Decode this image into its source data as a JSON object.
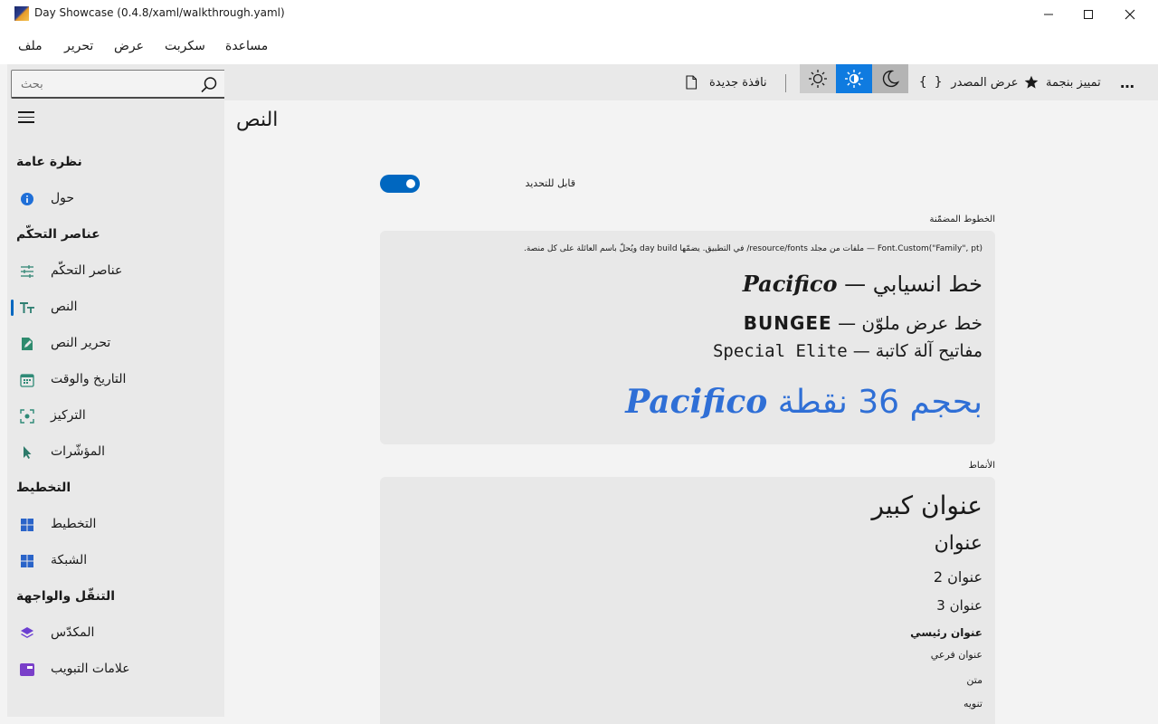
{
  "window": {
    "title": "Day Showcase (0.4.8/xaml/walkthrough.yaml)",
    "min_glyph": "—",
    "max_glyph": "☐",
    "close_glyph": "✕"
  },
  "menu": [
    "ملف",
    "تحرير",
    "عرض",
    "سكربت",
    "مساعدة"
  ],
  "search": {
    "placeholder": "بحث",
    "value": ""
  },
  "sidebar": {
    "sections": [
      "نظرة عامة",
      "عناصر التحكّم",
      "التخطيط",
      "التنقّل والواجهة"
    ],
    "items": [
      {
        "label": "حول",
        "icon": "info-icon"
      },
      {
        "label": "عناصر التحكّم",
        "icon": "sliders-icon"
      },
      {
        "label": "النص",
        "icon": "text-icon",
        "selected": true
      },
      {
        "label": "تحرير النص",
        "icon": "edit-text-icon"
      },
      {
        "label": "التاريخ والوقت",
        "icon": "calendar-icon"
      },
      {
        "label": "التركيز",
        "icon": "focus-icon"
      },
      {
        "label": "المؤشّرات",
        "icon": "pointer-icon"
      },
      {
        "label": "التخطيط",
        "icon": "layout-grid-icon"
      },
      {
        "label": "الشبكة",
        "icon": "grid-icon"
      },
      {
        "label": "المكدّس",
        "icon": "stack-layers-icon"
      },
      {
        "label": "علامات التبويب",
        "icon": "tabs-icon"
      }
    ]
  },
  "toolbar": {
    "new_window": "نافذة جديدة",
    "view_source": "عرض المصدر",
    "source_glyph": "{ }",
    "favorite": "تمييز بنجمة",
    "more": "…",
    "theme_modes": [
      "light",
      "auto",
      "dark"
    ],
    "active_theme": "auto"
  },
  "page": {
    "title": "النص",
    "toggle_label": "قابل للتحديد",
    "toggle_on": true
  },
  "embedded_fonts": {
    "label": "الخطوط المضمّنة",
    "note": "Font.Custom(\"Family\", pt) — ملفات من مجلد resource/fonts/ في التطبيق. يضمّها day build ويُحلّ باسم العائلة على كل منصة.",
    "pacifico_text": "خط انسيابي — ",
    "pacifico_name": "Pacifico",
    "bungee_text": "خط عرض ملوّن — ",
    "bungee_name": "BUNGEE",
    "special_text": "مفاتيح آلة كاتبة — ",
    "special_name": "Special Elite",
    "big_text": "بحجم 36 نقطة ",
    "big_name": "Pacifico"
  },
  "styles": {
    "label": "الأنماط",
    "title_large": "عنوان كبير",
    "title": "عنوان",
    "title2": "عنوان 2",
    "title3": "عنوان 3",
    "headline": "عنوان رئيسي",
    "subheadline": "عنوان فرعي",
    "body": "متن",
    "caption": "تنويه"
  },
  "colors": {
    "accent": "#0067c0",
    "big_text": "#2f6fd6",
    "sidebar_bg": "#e9e9e9",
    "card_bg": "#e8e8e8"
  }
}
